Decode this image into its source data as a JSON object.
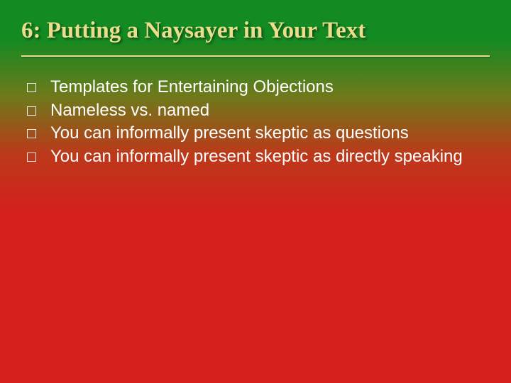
{
  "title": "6: Putting a Naysayer in Your Text",
  "bullets": [
    "Templates for Entertaining Objections",
    "Nameless vs. named",
    "You can informally present skeptic as questions",
    "You can informally present skeptic as directly speaking"
  ]
}
